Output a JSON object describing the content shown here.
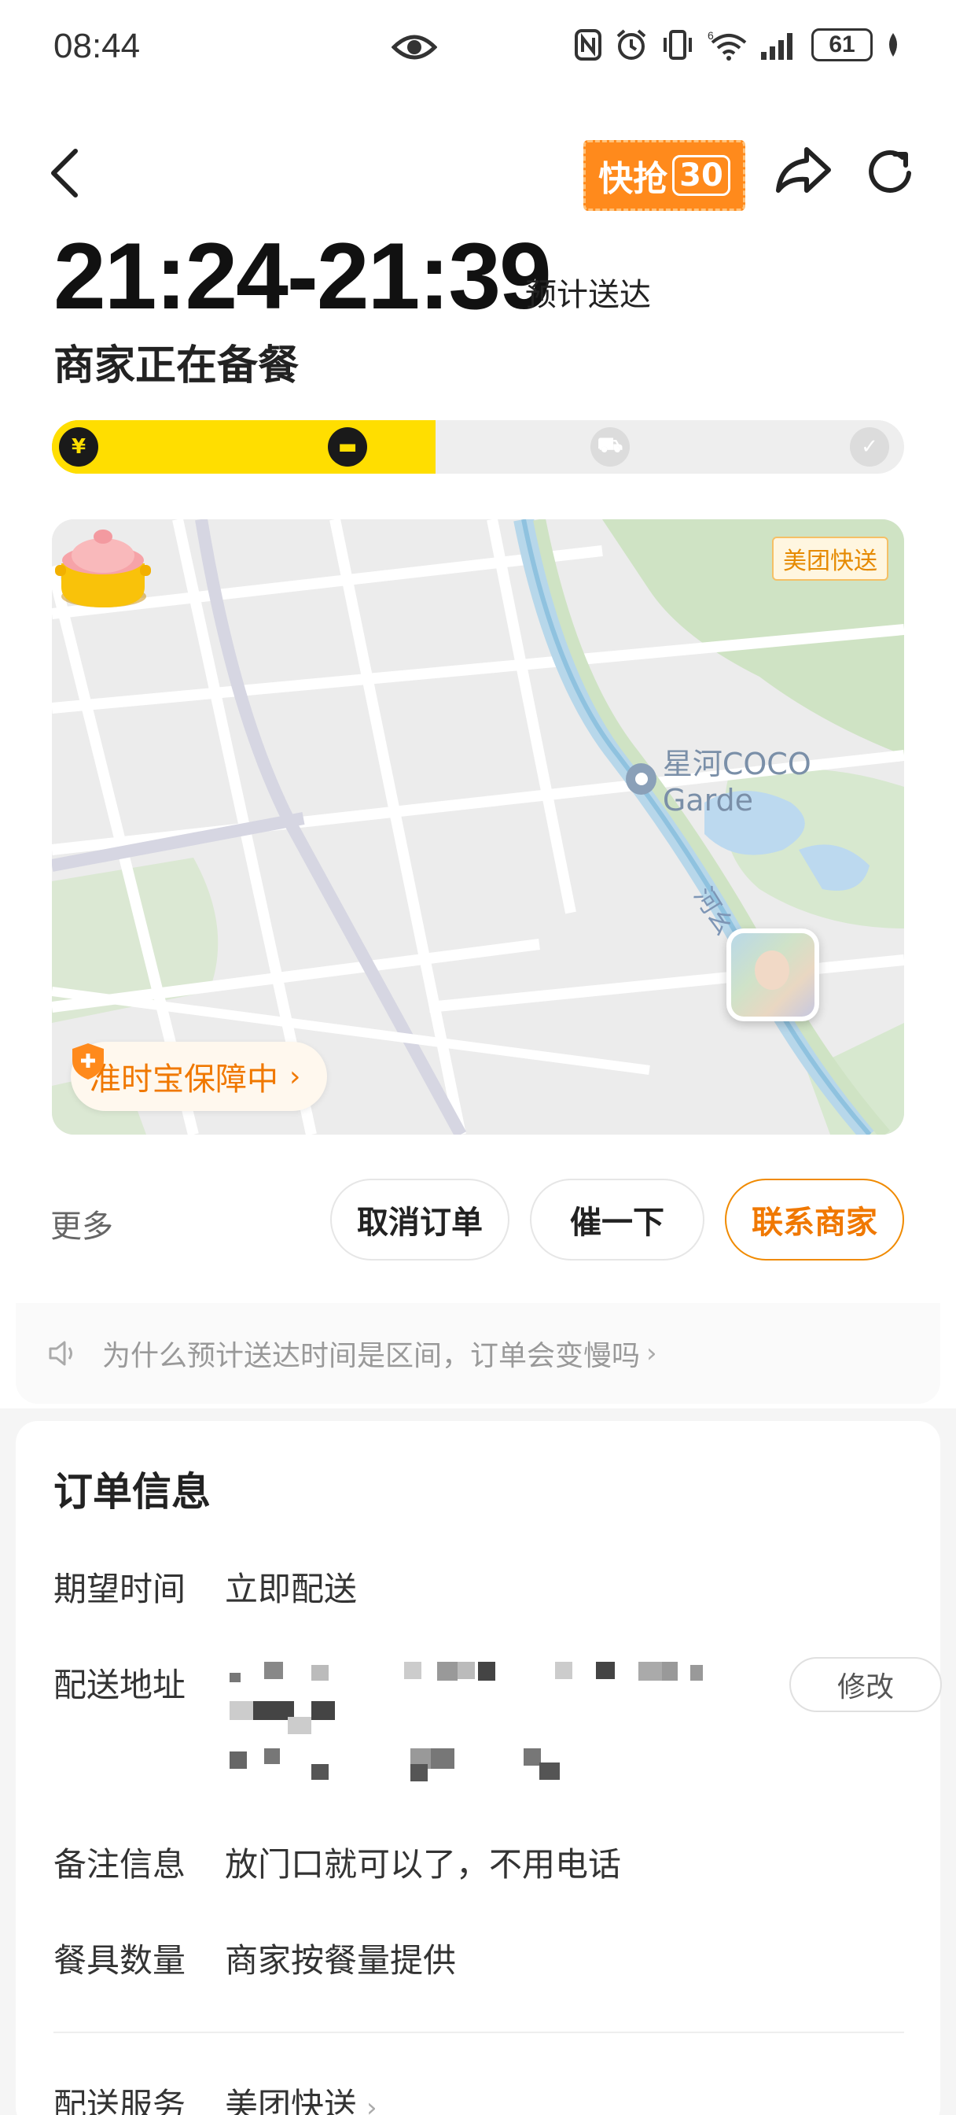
{
  "status_bar": {
    "time": "08:44",
    "battery": "61",
    "network_label": "6"
  },
  "header": {
    "promo_badge_label": "快抢",
    "promo_badge_number": "30",
    "eta_range": "21:24-21:39",
    "eta_suffix": "预计送达",
    "order_state": "商家正在备餐"
  },
  "progress": {
    "steps": [
      {
        "icon": "payment-yen-icon",
        "symbol": "¥",
        "done": true
      },
      {
        "icon": "cooking-pot-icon",
        "symbol": "▬",
        "done": true
      },
      {
        "icon": "delivery-scooter-icon",
        "symbol": "⛟",
        "done": false
      },
      {
        "icon": "check-icon",
        "symbol": "✓",
        "done": false
      }
    ],
    "filled_fraction": 0.45,
    "accent_color": "#ffde00"
  },
  "map": {
    "brand_tag": "美团快送",
    "poi_label": "星河COCO Garde",
    "river_label": "河幺",
    "guarantee_label": "准时宝保障中",
    "guarantee_chevron": "›"
  },
  "actions": {
    "more_label": "更多",
    "cancel_label": "取消订单",
    "urge_label": "催一下",
    "contact_label": "联系商家",
    "accent_color": "#f07800"
  },
  "notice": {
    "text": "为什么预计送达时间是区间，订单会变慢吗",
    "chevron": "›"
  },
  "order_info": {
    "title": "订单信息",
    "expected_time_label": "期望时间",
    "expected_time_value": "立即配送",
    "address_label": "配送地址",
    "edit_label": "修改",
    "remark_label": "备注信息",
    "remark_value": "放门口就可以了，不用电话",
    "utensils_label": "餐具数量",
    "utensils_value": "商家按餐量提供",
    "service_label": "配送服务",
    "service_value": "美团快送",
    "service_chevron": "›"
  }
}
